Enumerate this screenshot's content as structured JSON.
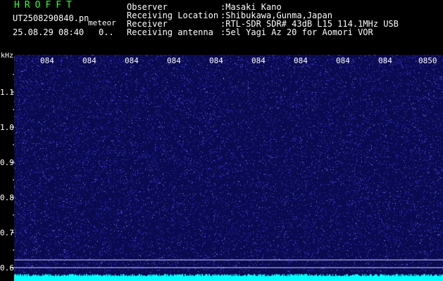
{
  "header": {
    "logo": "HROFFT",
    "filename": "UT2508290840.pn",
    "mode": "meteor",
    "datetime": "25.08.29 08:40",
    "extra": "0.."
  },
  "info": [
    {
      "label": "Observer",
      "value": ":Masaki Kano"
    },
    {
      "label": "Receiving Location",
      "value": ":Shibukawa,Gunma,Japan"
    },
    {
      "label": "Receiver",
      "value": ":RTL-SDR SDR# 43dB L15 114.1MHz USB"
    },
    {
      "label": "Receiving antenna",
      "value": ":5el Yagi Az 20 for Aomori VOR"
    }
  ],
  "spectrogram": {
    "freq_unit": "kHz",
    "freq_labels": [
      "1.1",
      "1.0",
      "0.9",
      "0.8",
      "0.7",
      "0.6"
    ],
    "time_labels": [
      "084",
      "084",
      "084",
      "084",
      "084",
      "084",
      "084",
      "084",
      "084",
      "0850"
    ],
    "colors": {
      "background": "#0a0a50",
      "noise": "#3a3ad8",
      "noise_bright": "#8a8aff",
      "signal": "#00ffff",
      "reference_line": "#c8c8ff"
    }
  }
}
